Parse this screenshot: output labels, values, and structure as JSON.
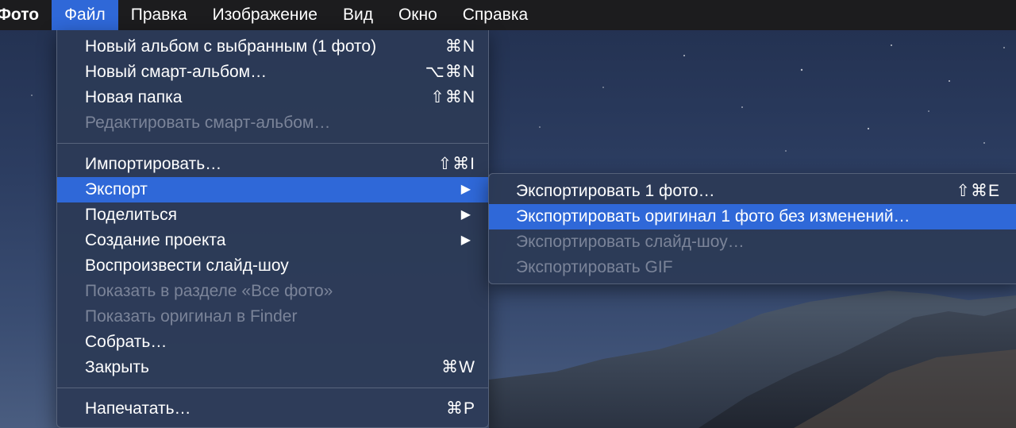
{
  "menubar": {
    "app": "Фото",
    "items": [
      "Файл",
      "Правка",
      "Изображение",
      "Вид",
      "Окно",
      "Справка"
    ]
  },
  "file_menu": {
    "group1": [
      {
        "label": "Новый альбом с выбранным (1 фото)",
        "shortcut": "⌘N",
        "enabled": true
      },
      {
        "label": "Новый смарт-альбом…",
        "shortcut": "⌥⌘N",
        "enabled": true
      },
      {
        "label": "Новая папка",
        "shortcut": "⇧⌘N",
        "enabled": true
      },
      {
        "label": "Редактировать смарт-альбом…",
        "shortcut": "",
        "enabled": false
      }
    ],
    "group2": [
      {
        "label": "Импортировать…",
        "shortcut": "⇧⌘I",
        "enabled": true
      },
      {
        "label": "Экспорт",
        "submenu": true,
        "enabled": true,
        "highlighted": true
      },
      {
        "label": "Поделиться",
        "submenu": true,
        "enabled": true
      },
      {
        "label": "Создание проекта",
        "submenu": true,
        "enabled": true
      },
      {
        "label": "Воспроизвести слайд-шоу",
        "shortcut": "",
        "enabled": true
      },
      {
        "label": "Показать в разделе «Все фото»",
        "shortcut": "",
        "enabled": false
      },
      {
        "label": "Показать оригинал в Finder",
        "shortcut": "",
        "enabled": false
      },
      {
        "label": "Собрать…",
        "shortcut": "",
        "enabled": true
      },
      {
        "label": "Закрыть",
        "shortcut": "⌘W",
        "enabled": true
      }
    ],
    "group3": [
      {
        "label": "Напечатать…",
        "shortcut": "⌘P",
        "enabled": true
      }
    ]
  },
  "export_submenu": [
    {
      "label": "Экспортировать 1 фото…",
      "shortcut": "⇧⌘E",
      "enabled": true
    },
    {
      "label": "Экспортировать оригинал 1 фото без изменений…",
      "shortcut": "",
      "enabled": true,
      "highlighted": true
    },
    {
      "label": "Экспортировать слайд-шоу…",
      "shortcut": "",
      "enabled": false
    },
    {
      "label": "Экспортировать GIF",
      "shortcut": "",
      "enabled": false
    }
  ],
  "icons": {
    "submenu_arrow": "▶"
  },
  "colors": {
    "menubar_bg": "#1c1c1e",
    "highlight": "#2f68d8",
    "menu_bg": "#2c3a56",
    "disabled_text": "#7b8499"
  }
}
